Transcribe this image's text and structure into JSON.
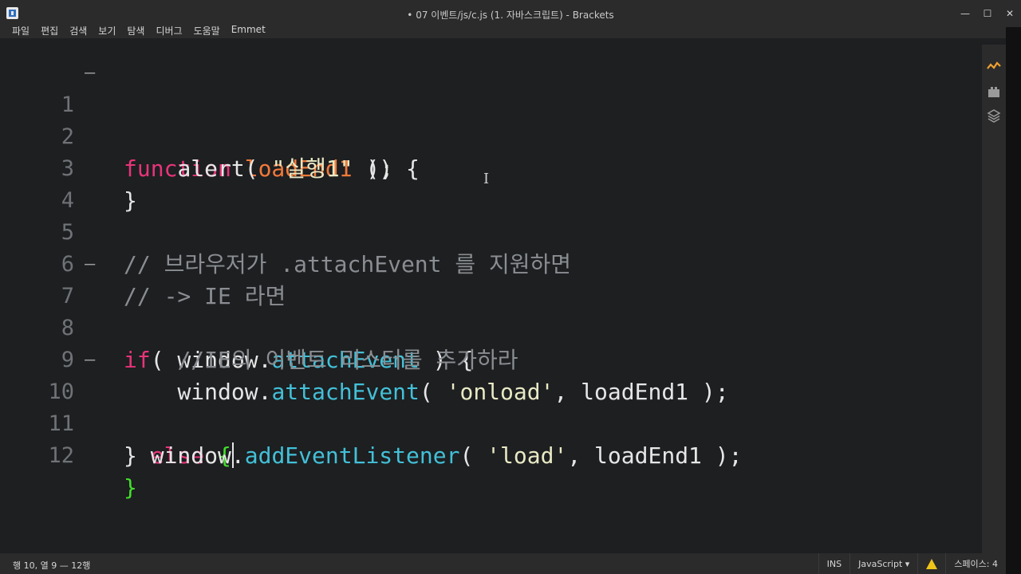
{
  "window": {
    "title": "• 07 이벤트/js/c.js (1. 자바스크립트) - Brackets",
    "minimize": "—",
    "maximize": "☐",
    "close": "✕"
  },
  "menu": [
    "파일",
    "편집",
    "검색",
    "보기",
    "탐색",
    "디버그",
    "도움말",
    "Emmet"
  ],
  "editor": {
    "lines": [
      {
        "n": "1",
        "fold": "—"
      },
      {
        "n": "2"
      },
      {
        "n": "3"
      },
      {
        "n": "4"
      },
      {
        "n": "5"
      },
      {
        "n": "6"
      },
      {
        "n": "7",
        "fold": "—"
      },
      {
        "n": "8"
      },
      {
        "n": "9"
      },
      {
        "n": "10",
        "fold": "—"
      },
      {
        "n": "11"
      },
      {
        "n": "12"
      }
    ],
    "tokens": {
      "l1_kw": "function",
      "l1_fn": "loadEnd1",
      "l1_rest": " () {",
      "l2_indent": "    ",
      "l2_call": "alert( ",
      "l2_str": "\"실행1\"",
      "l2_rest": " );",
      "l3": "}",
      "l5": "// 브라우저가 .attachEvent 를 지원하면",
      "l6": "// -> IE 라면",
      "l7_kw": "if",
      "l7_a": "( window.",
      "l7_prop": "attachEvent",
      "l7_b": " ) {",
      "l8_indent": "    ",
      "l8": "//IE의 이벤트 리스터를 추가하라",
      "l9_indent": "    ",
      "l9_a": "window.",
      "l9_prop": "attachEvent",
      "l9_b": "( ",
      "l9_str": "'onload'",
      "l9_c": ", loadEnd1 );",
      "l10_a": "} ",
      "l10_kw": "else",
      "l10_sp": " ",
      "l10_brace": "{",
      "l11_indent": "  ",
      "l11_a": "window.",
      "l11_prop": "addEventListener",
      "l11_b": "( ",
      "l11_str": "'load'",
      "l11_c": ", loadEnd1 );",
      "l12": "}"
    }
  },
  "status": {
    "position": "행 10, 열 9 — 12행",
    "mode": "INS",
    "language": "JavaScript ▾",
    "spaces": "스페이스: 4"
  },
  "colors": {
    "keyword": "#e8347a",
    "function_name": "#f2793a",
    "property": "#43c0d8",
    "comment": "#8a8d91",
    "matched_brace": "#44e02c",
    "warning": "#f0c419"
  }
}
